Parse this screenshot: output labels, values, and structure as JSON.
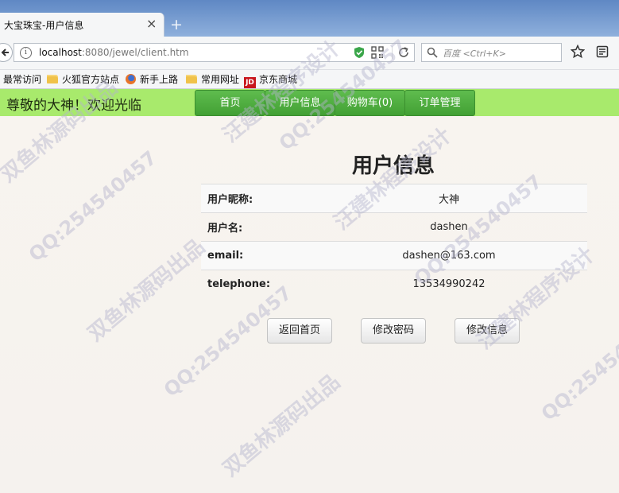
{
  "browser": {
    "tab_title": "大宝珠宝-用户信息",
    "tab_close": "×",
    "new_tab": "+",
    "url_host": "localhost",
    "url_path": ":8080/jewel/client.htm",
    "search_placeholder": "百度 <Ctrl+K>",
    "bookmarks": [
      {
        "label": "最常访问",
        "icon": "none"
      },
      {
        "label": "火狐官方站点",
        "icon": "folder-icon"
      },
      {
        "label": "新手上路",
        "icon": "firefox-icon"
      },
      {
        "label": "常用网址",
        "icon": "folder-icon"
      },
      {
        "label": "京东商城",
        "icon": "jd-icon",
        "icon_text": "JD"
      }
    ]
  },
  "header": {
    "welcome": "尊敬的大神！欢迎光临",
    "menu": [
      {
        "label": "首页"
      },
      {
        "label": "用户信息"
      },
      {
        "label": "购物车(0)"
      },
      {
        "label": "订单管理"
      }
    ]
  },
  "main": {
    "title": "用户信息",
    "rows": [
      {
        "label": "用户昵称:",
        "value": "大神"
      },
      {
        "label": "用户名:",
        "value": "dashen"
      },
      {
        "label": "email:",
        "value": "dashen@163.com"
      },
      {
        "label": "telephone:",
        "value": "13534990242"
      }
    ],
    "buttons": {
      "home": "返回首页",
      "change_password": "修改密码",
      "edit_info": "修改信息"
    }
  },
  "watermarks": [
    "QQ:254540457",
    "汪建林程序设计",
    "双鱼林源码出品"
  ],
  "colors": {
    "header_bg": "#a8ea6c",
    "menu_bg": "#4cae3c",
    "tab_strip": "#6d93cc"
  }
}
